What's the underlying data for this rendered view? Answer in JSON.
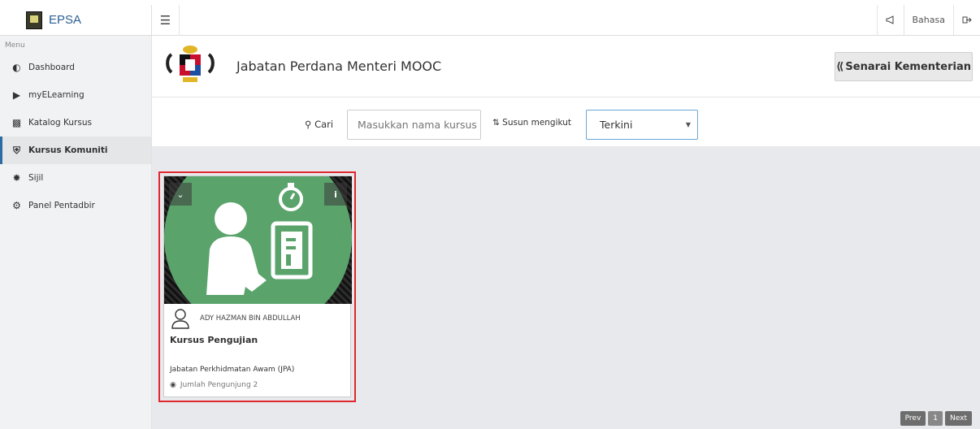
{
  "brand": {
    "name": "EPSA"
  },
  "topbar": {
    "menu_icon": "hamburger-icon",
    "bahasa": "Bahasa",
    "announce_icon": "bullhorn-icon",
    "logout_icon": "sign-out-icon"
  },
  "sidebar": {
    "menu_label": "Menu",
    "items": [
      {
        "label": "Dashboard",
        "icon": "dashboard-icon"
      },
      {
        "label": "myELearning",
        "icon": "play-square-icon"
      },
      {
        "label": "Katalog Kursus",
        "icon": "book-icon"
      },
      {
        "label": "Kursus Komuniti",
        "icon": "shield-icon",
        "active": true
      },
      {
        "label": "Sijil",
        "icon": "certificate-icon"
      },
      {
        "label": "Panel Pentadbir",
        "icon": "cogs-icon"
      }
    ]
  },
  "header": {
    "title": "Jabatan Perdana Menteri MOOC",
    "back_button": "Senarai Kementerian"
  },
  "search": {
    "label": "Cari",
    "placeholder": "Masukkan nama kursus",
    "sort_label": "Susun mengikut",
    "sort_value": "Terkini"
  },
  "card": {
    "author": "ADY HAZMAN BIN ABDULLAH",
    "title": "Kursus Pengujian",
    "agency": "Jabatan Perkhidmatan Awam (JPA)",
    "visits": "Jumlah Pengunjung 2",
    "accent": "#5aa36b"
  },
  "pager": {
    "prev": "Prev",
    "page": "1",
    "next": "Next"
  }
}
